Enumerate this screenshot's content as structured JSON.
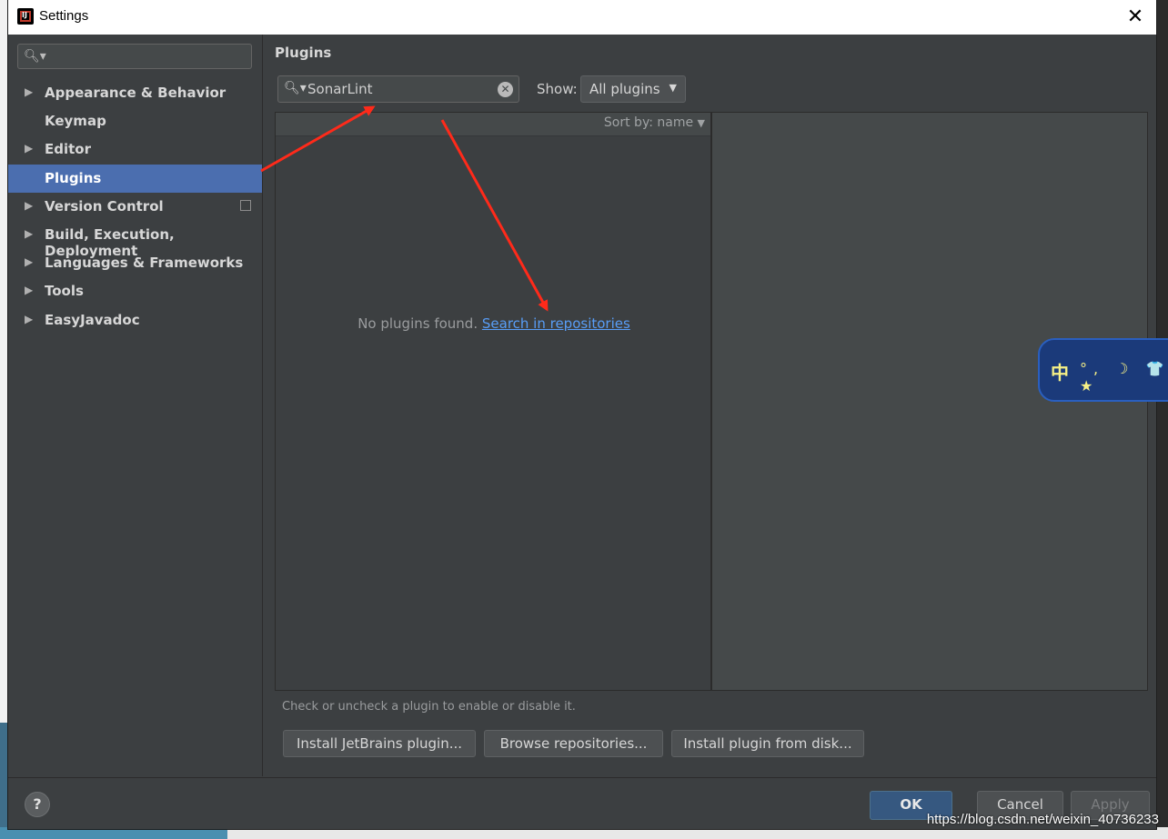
{
  "window": {
    "title": "Settings",
    "close_glyph": "✕",
    "app_icon": "intellij-icon"
  },
  "sidebar": {
    "search_icon": "search-icon",
    "items": [
      {
        "label": "Appearance & Behavior",
        "has_arrow": true
      },
      {
        "label": "Keymap",
        "has_arrow": false
      },
      {
        "label": "Editor",
        "has_arrow": true
      },
      {
        "label": "Plugins",
        "has_arrow": false,
        "selected": true
      },
      {
        "label": "Version Control",
        "has_arrow": true,
        "has_project_icon": true
      },
      {
        "label": "Build, Execution, Deployment",
        "has_arrow": true
      },
      {
        "label": "Languages & Frameworks",
        "has_arrow": true
      },
      {
        "label": "Tools",
        "has_arrow": true
      },
      {
        "label": "EasyJavadoc",
        "has_arrow": true
      }
    ],
    "help_label": "?"
  },
  "main": {
    "title": "Plugins",
    "search": {
      "value": "SonarLint"
    },
    "show": {
      "label": "Show:",
      "selected": "All plugins"
    },
    "list": {
      "sort_label": "Sort by: name",
      "empty_text": "No plugins found.",
      "search_link": "Search in repositories"
    },
    "hint": "Check or uncheck a plugin to enable or disable it.",
    "buttons": {
      "install_jetbrains": "Install JetBrains plugin...",
      "browse": "Browse repositories...",
      "install_disk": "Install plugin from disk..."
    }
  },
  "footer": {
    "ok": "OK",
    "cancel": "Cancel",
    "apply": "Apply"
  },
  "ime": {
    "label": "中",
    "symbols": "°, ☽ 👕 ★"
  },
  "watermark": "https://blog.csdn.net/weixin_40736233",
  "colors": {
    "accent": "#4b6eaf",
    "link": "#589df6",
    "annotation": "#ff2a1a",
    "ok_button": "#365880"
  }
}
